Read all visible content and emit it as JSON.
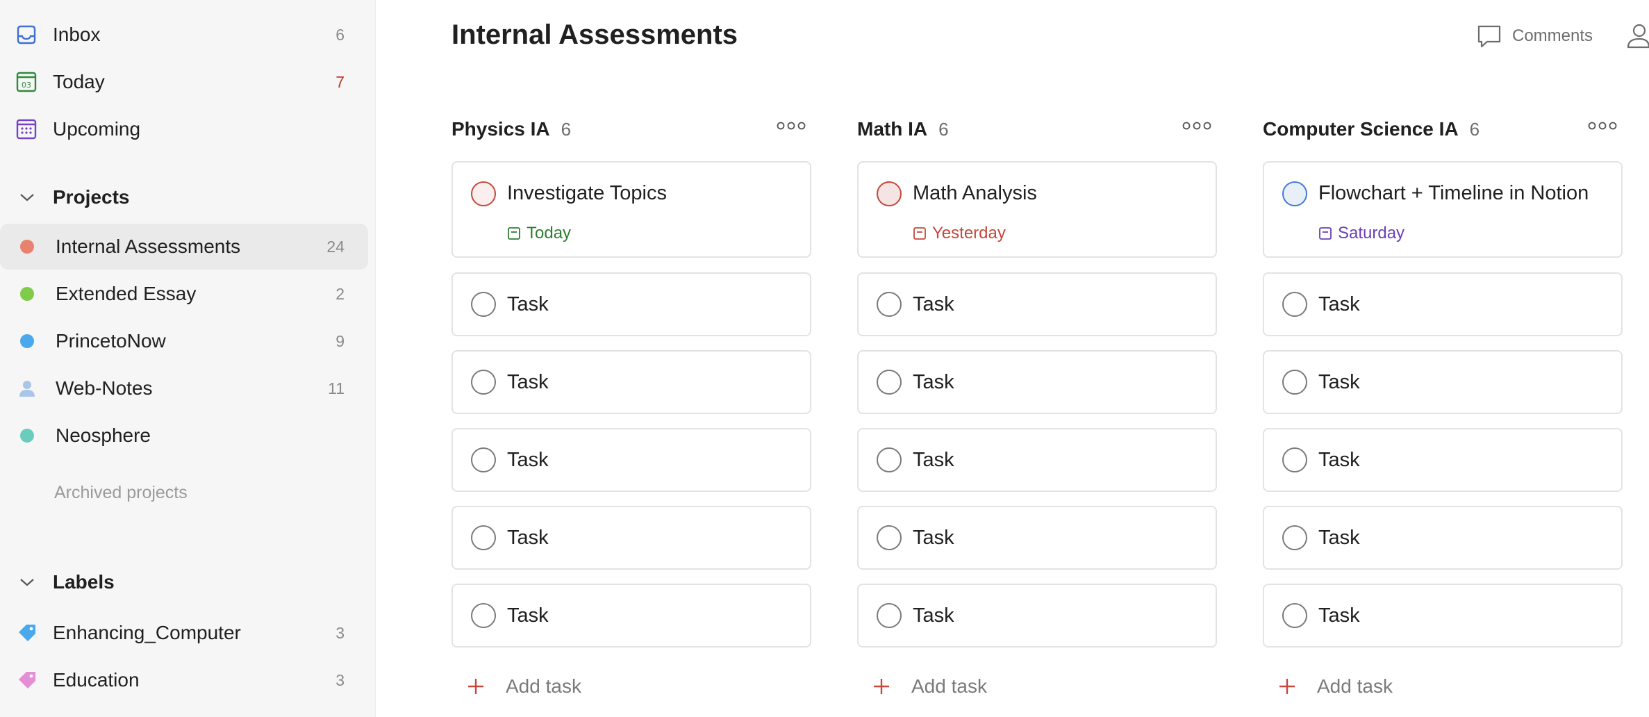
{
  "sidebar": {
    "nav": [
      {
        "label": "Inbox",
        "count": "6",
        "icon": "inbox-icon"
      },
      {
        "label": "Today",
        "count": "7",
        "icon": "calendar-today-icon",
        "day": "03"
      },
      {
        "label": "Upcoming",
        "count": "",
        "icon": "calendar-grid-icon"
      }
    ],
    "projects_heading": "Projects",
    "projects": [
      {
        "label": "Internal Assessments",
        "count": "24",
        "color": "#e8826f"
      },
      {
        "label": "Extended Essay",
        "count": "2",
        "color": "#7ecc49"
      },
      {
        "label": "PrincetoNow",
        "count": "9",
        "color": "#4aa8ee"
      },
      {
        "label": "Web-Notes",
        "count": "11",
        "color": "#a9c6e8"
      },
      {
        "label": "Neosphere",
        "count": "",
        "color": "#6accbc"
      }
    ],
    "archived_label": "Archived projects",
    "labels_heading": "Labels",
    "labels": [
      {
        "label": "Enhancing_Computer",
        "count": "3",
        "color": "#4aa8ee"
      },
      {
        "label": "Education",
        "count": "3",
        "color": "#e48ed8"
      }
    ]
  },
  "header": {
    "title": "Internal Assessments",
    "comments_label": "Comments"
  },
  "columns": [
    {
      "title": "Physics IA",
      "count": "6",
      "first_task": {
        "title": "Investigate Topics",
        "due": "Today",
        "due_color": "#2f7d32",
        "priority_color": "#c5473a"
      },
      "tasks": [
        "Task",
        "Task",
        "Task",
        "Task",
        "Task"
      ],
      "add_label": "Add task"
    },
    {
      "title": "Math IA",
      "count": "6",
      "first_task": {
        "title": "Math Analysis",
        "due": "Yesterday",
        "due_color": "#c5473a",
        "priority_color": "#c5473a"
      },
      "tasks": [
        "Task",
        "Task",
        "Task",
        "Task",
        "Task"
      ],
      "add_label": "Add task"
    },
    {
      "title": "Computer Science IA",
      "count": "6",
      "first_task": {
        "title": "Flowchart + Timeline in Notion",
        "due": "Saturday",
        "due_color": "#6a3fb5",
        "priority_color": "#3f7bd6"
      },
      "tasks": [
        "Task",
        "Task",
        "Task",
        "Task",
        "Task"
      ],
      "add_label": "Add task"
    }
  ],
  "colors": {
    "accent": "#c5473a",
    "today_red": "#c0392b"
  }
}
